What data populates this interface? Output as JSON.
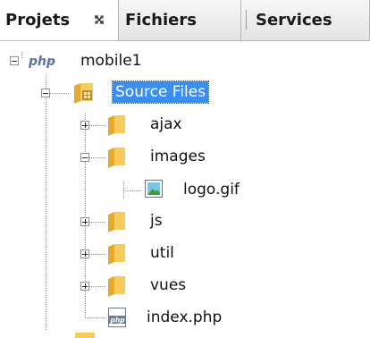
{
  "tabs": {
    "projets": "Projets",
    "fichiers": "Fichiers",
    "services": "Services"
  },
  "tree": {
    "project": "mobile1",
    "source_files": "Source Files",
    "ajax": "ajax",
    "images": "images",
    "logo": "logo.gif",
    "js": "js",
    "util": "util",
    "vues": "vues",
    "index": "index.php"
  },
  "icons": {
    "project": "php-project-icon",
    "source_files": "source-package-icon",
    "folder": "folder-icon",
    "gif": "gif-file-icon",
    "php": "php-file-icon",
    "close": "close-icon"
  },
  "colors": {
    "selection": "#3b8ef0",
    "folder": "#f2c24a",
    "php_badge": "#6c7fa0"
  }
}
